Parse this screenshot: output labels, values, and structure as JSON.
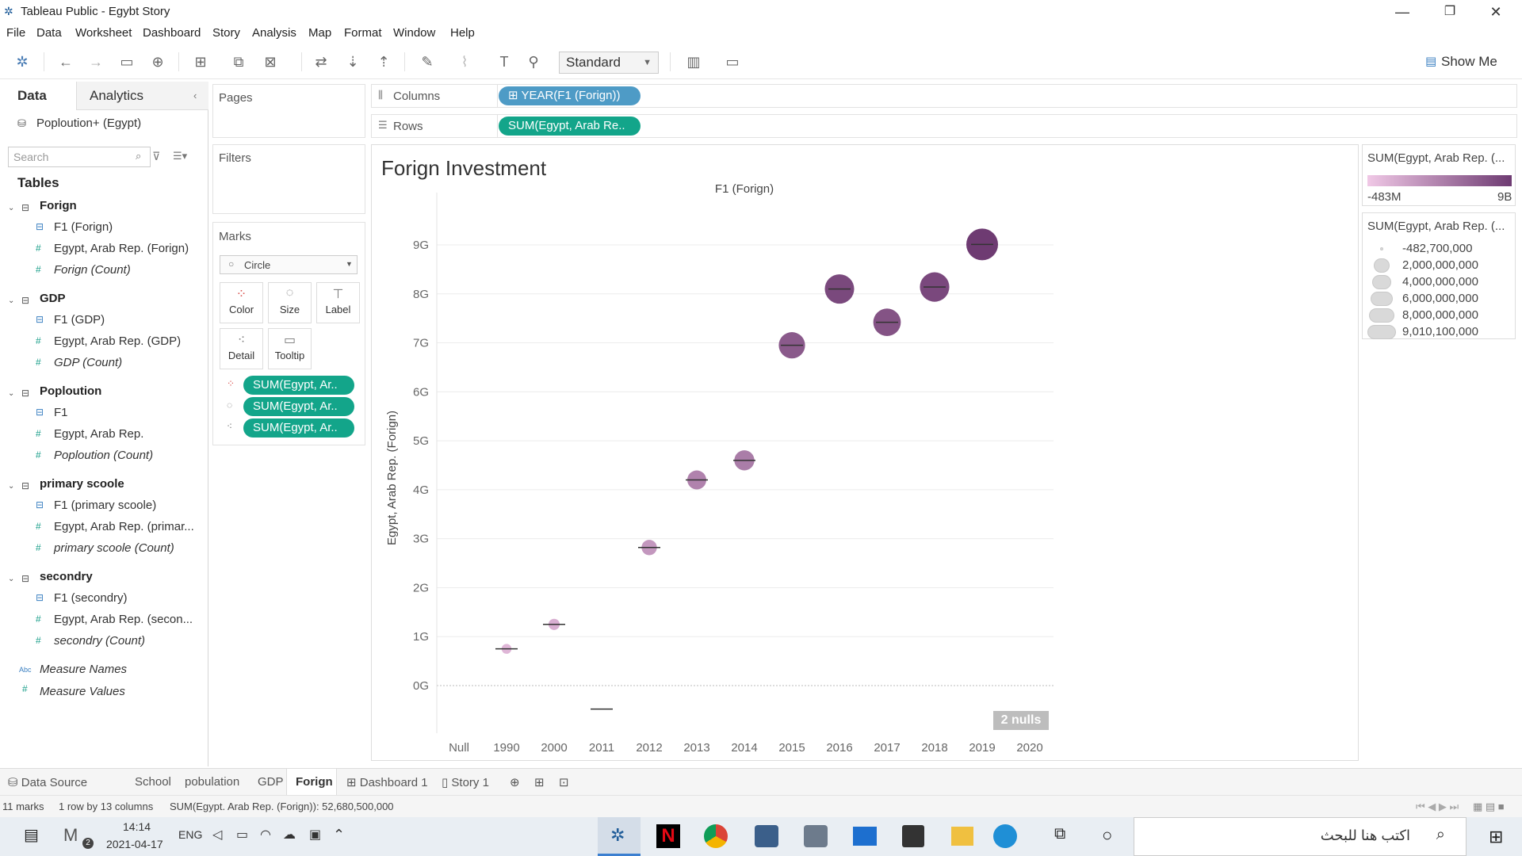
{
  "window": {
    "title": "Tableau Public - Egybt Story",
    "minimize": "—",
    "restore": "❐",
    "close": "✕"
  },
  "menu": [
    "File",
    "Data",
    "Worksheet",
    "Dashboard",
    "Story",
    "Analysis",
    "Map",
    "Format",
    "Window",
    "Help"
  ],
  "toolbar": {
    "fit_value": "Standard",
    "show_me": "Show Me"
  },
  "data_pane": {
    "tab_data": "Data",
    "tab_analytics": "Analytics",
    "datasource": "Poploution+ (Egypt)",
    "search_placeholder": "Search",
    "tables_header": "Tables",
    "tables": [
      {
        "name": "Forign",
        "fields": [
          "F1 (Forign)",
          "Egypt, Arab Rep. (Forign)",
          "Forign (Count)"
        ]
      },
      {
        "name": "GDP",
        "fields": [
          "F1 (GDP)",
          "Egypt, Arab Rep. (GDP)",
          "GDP (Count)"
        ]
      },
      {
        "name": "Poploution",
        "fields": [
          "F1",
          "Egypt, Arab Rep.",
          "Poploution (Count)"
        ]
      },
      {
        "name": "primary scoole",
        "fields": [
          "F1 (primary scoole)",
          "Egypt, Arab Rep. (primar...",
          "primary scoole (Count)"
        ]
      },
      {
        "name": "secondry",
        "fields": [
          "F1 (secondry)",
          "Egypt, Arab Rep. (secon...",
          "secondry (Count)"
        ]
      }
    ],
    "measure_names": "Measure Names",
    "measure_values": "Measure Values"
  },
  "shelves": {
    "pages": "Pages",
    "filters": "Filters",
    "columns_label": "Columns",
    "rows_label": "Rows",
    "columns_pill": "⊞ YEAR(F1 (Forign))",
    "rows_pill": "SUM(Egypt, Arab Re.."
  },
  "marks": {
    "header": "Marks",
    "type": "Circle",
    "buttons": [
      "Color",
      "Size",
      "Label",
      "Detail",
      "Tooltip"
    ],
    "pills": [
      "SUM(Egypt, Ar..",
      "SUM(Egypt, Ar..",
      "SUM(Egypt, Ar.."
    ]
  },
  "view": {
    "title": "Forign Investment",
    "nulls_badge": "2 nulls"
  },
  "legends": {
    "color_title": "SUM(Egypt, Arab Rep. (...",
    "color_min": "-483M",
    "color_max": "9B",
    "color_low": "#f0c8e6",
    "color_high": "#6e3b72",
    "size_title": "SUM(Egypt, Arab Rep. (...",
    "size_items": [
      "-482,700,000",
      "2,000,000,000",
      "4,000,000,000",
      "6,000,000,000",
      "8,000,000,000",
      "9,010,100,000"
    ]
  },
  "chart_data": {
    "type": "scatter",
    "title": "",
    "xlabel": "F1 (Forign)",
    "ylabel": "Egypt, Arab Rep. (Forign)",
    "categories": [
      "Null",
      "1990",
      "2000",
      "2011",
      "2012",
      "2013",
      "2014",
      "2015",
      "2016",
      "2017",
      "2018",
      "2019",
      "2020"
    ],
    "y_ticks": [
      "9G",
      "8G",
      "7G",
      "6G",
      "5G",
      "4G",
      "3G",
      "2G",
      "1G",
      "0G"
    ],
    "ylim": [
      -0.8,
      9.8
    ],
    "points": [
      {
        "x": "1990",
        "y": 0.75
      },
      {
        "x": "2000",
        "y": 1.25
      },
      {
        "x": "2011",
        "y": -0.48
      },
      {
        "x": "2012",
        "y": 2.82
      },
      {
        "x": "2013",
        "y": 4.2
      },
      {
        "x": "2014",
        "y": 4.6
      },
      {
        "x": "2015",
        "y": 6.95
      },
      {
        "x": "2016",
        "y": 8.1
      },
      {
        "x": "2017",
        "y": 7.42
      },
      {
        "x": "2018",
        "y": 8.14
      },
      {
        "x": "2019",
        "y": 9.01
      }
    ]
  },
  "sheet_tabs": [
    "Data Source",
    "School",
    "pobulation",
    "GDP",
    "Forign",
    "Dashboard 1",
    "Story 1"
  ],
  "active_tab": "Forign",
  "status": {
    "marks": "11 marks",
    "rows": "1 row by 13 columns",
    "sum": "SUM(Egypt. Arab Rep. (Forign)): 52,680,500,000"
  },
  "taskbar": {
    "time": "14:14",
    "date": "2021-04-17",
    "lang": "ENG",
    "search_placeholder": "اكتب هنا للبحث",
    "badge": "2"
  }
}
